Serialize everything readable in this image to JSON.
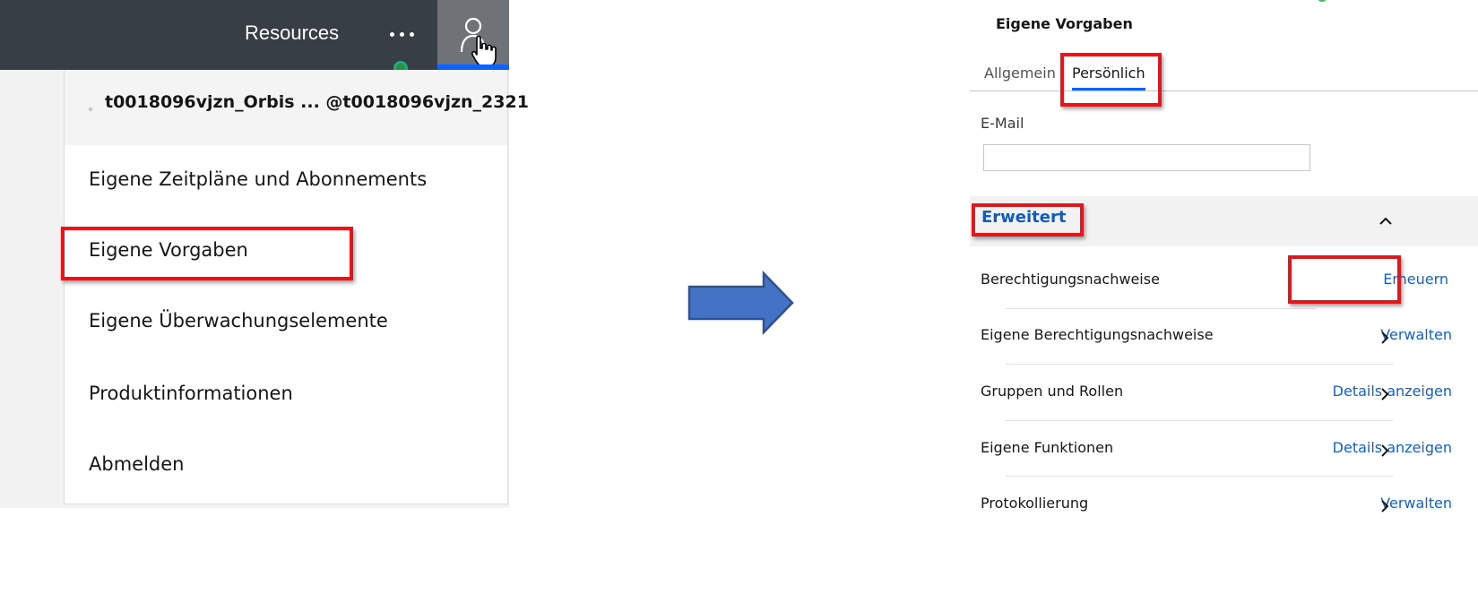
{
  "header": {
    "resources_label": "Resources",
    "more_label": "•••"
  },
  "user_menu": {
    "user_name": "t0018096vjzn_Orbis ... @t0018096vjzn_2321",
    "items": [
      {
        "label": "Eigene Zeitpläne und Abonnements"
      },
      {
        "label": "Eigene Vorgaben"
      },
      {
        "label": "Eigene Überwachungselemente"
      },
      {
        "label": "Produktinformationen"
      },
      {
        "label": "Abmelden"
      }
    ],
    "highlighted_item": "Eigene Vorgaben"
  },
  "preferences": {
    "title": "Eigene Vorgaben",
    "tabs": [
      {
        "label": "Allgemein",
        "selected": false
      },
      {
        "label": "Persönlich",
        "selected": true
      }
    ],
    "email": {
      "label": "E-Mail",
      "value": "",
      "placeholder": ""
    },
    "advanced": {
      "title": "Erweitert",
      "expanded": true,
      "rows": [
        {
          "label": "Berechtigungsnachweise",
          "action": "Erneuern"
        },
        {
          "label": "Eigene Berechtigungsnachweise",
          "action": "Verwalten"
        },
        {
          "label": "Gruppen und Rollen",
          "action": "Details anzeigen"
        },
        {
          "label": "Eigene Funktionen",
          "action": "Details anzeigen"
        },
        {
          "label": "Protokollierung",
          "action": "Verwalten"
        }
      ]
    }
  },
  "colors": {
    "topbar": "#383e46",
    "highlight": "#e8141c",
    "link": "#0f62cc",
    "accent": "#0f62fe",
    "arrow_fill": "#4472c4",
    "arrow_stroke": "#2f528f"
  }
}
